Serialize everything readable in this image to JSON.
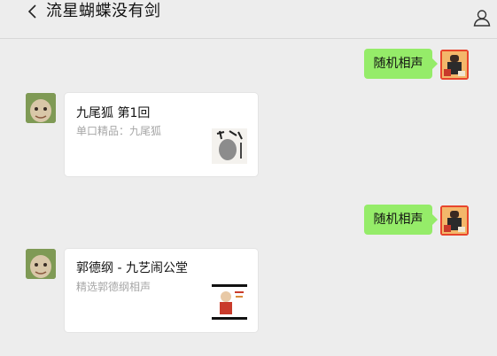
{
  "header": {
    "title": "流星蝴蝶没有剑",
    "back_icon": "chevron-left-icon",
    "profile_icon": "user-icon"
  },
  "messages": [
    {
      "type": "text",
      "side": "right",
      "text": "随机相声"
    },
    {
      "type": "link_card",
      "side": "left",
      "title": "九尾狐 第1回",
      "desc": "单口精品：九尾狐"
    },
    {
      "type": "text",
      "side": "right",
      "text": "随机相声"
    },
    {
      "type": "link_card",
      "side": "left",
      "title": "郭德纲 - 九艺闹公堂",
      "desc": "精选郭德纲相声"
    }
  ],
  "colors": {
    "background": "#ededed",
    "self_bubble": "#95ec69",
    "card": "#ffffff",
    "desc_text": "#a6a6a6"
  }
}
